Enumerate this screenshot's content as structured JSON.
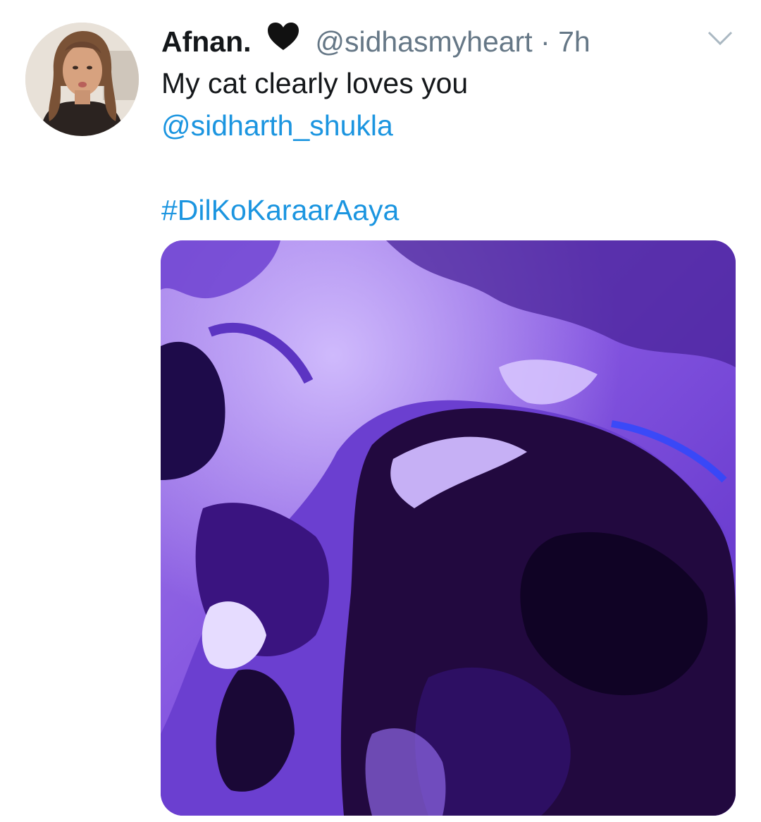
{
  "tweet": {
    "display_name": "Afnan.",
    "handle": "@sidhasmyheart",
    "separator": "·",
    "time": "7h",
    "text": "My cat clearly loves you",
    "mention": "@sidharth_shukla",
    "hashtag": "#DilKoKaraarAaya"
  },
  "icons": {
    "verified_like": "black-heart-icon",
    "menu": "chevron-down-icon"
  },
  "colors": {
    "link": "#1b95e0",
    "text": "#14171a",
    "muted": "#657786",
    "media_tint": "#7a3fd6"
  }
}
